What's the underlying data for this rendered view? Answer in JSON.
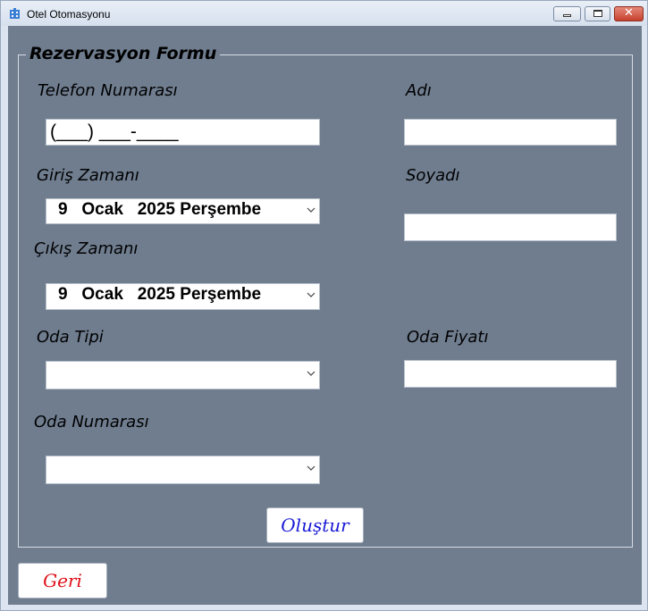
{
  "window": {
    "title": "Otel Otomasyonu",
    "icon": "hotel-app-icon",
    "controls": [
      "minimize-icon",
      "maximize-icon",
      "close-icon"
    ]
  },
  "form": {
    "group_title": "Rezervasyon Formu",
    "phone": {
      "label": "Telefon Numarası",
      "mask": "(___) ___-____"
    },
    "first_name": {
      "label": "Adı",
      "value": ""
    },
    "last_name": {
      "label": "Soyadı",
      "value": ""
    },
    "checkin": {
      "label": "Giriş Zamanı",
      "value": "9   Ocak   2025 Perşembe"
    },
    "checkout": {
      "label": "Çıkış Zamanı",
      "value": "9   Ocak   2025 Perşembe"
    },
    "room_type": {
      "label": "Oda Tipi",
      "selected": ""
    },
    "room_price": {
      "label": "Oda Fiyatı",
      "value": ""
    },
    "room_number": {
      "label": "Oda Numarası",
      "selected": ""
    },
    "create_button": {
      "label": "Oluştur",
      "color": "#1a1ad6"
    },
    "back_button": {
      "label": "Geri",
      "color": "#e0111a"
    }
  },
  "colors": {
    "client_background": "#6f7d8f",
    "frame": "#dbe4f0"
  }
}
